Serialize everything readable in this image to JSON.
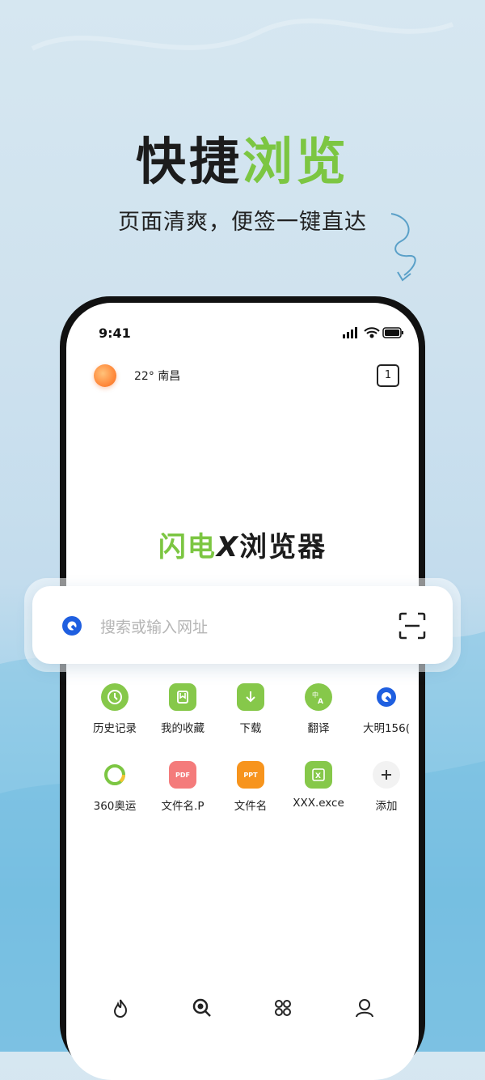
{
  "hero": {
    "title_dark": "快捷",
    "title_green": "浏览",
    "subtitle": "页面清爽，便签一键直达"
  },
  "status_bar": {
    "time": "9:41"
  },
  "header": {
    "weather": "22° 南昌",
    "tab_count": "1"
  },
  "logo": {
    "part1": "闪电",
    "part2": "X",
    "part3": "浏览器"
  },
  "search": {
    "placeholder": "搜索或输入网址"
  },
  "shortcuts_row1": [
    {
      "label": "历史记录",
      "icon": "clock-icon",
      "color": "#86c84a"
    },
    {
      "label": "我的收藏",
      "icon": "bookmark-icon",
      "color": "#86c84a"
    },
    {
      "label": "下载",
      "icon": "download-icon",
      "color": "#86c84a"
    },
    {
      "label": "翻译",
      "icon": "translate-icon",
      "color": "#86c84a"
    },
    {
      "label": "大明156(",
      "icon": "browser-logo-icon",
      "color": "#1f5fe0"
    }
  ],
  "shortcuts_row2": [
    {
      "label": "360奥运",
      "icon": "ring-logo-icon",
      "color": "#7cc642"
    },
    {
      "label": "文件名.P",
      "icon": "pdf-icon",
      "color": "#f47b7b",
      "badge": "PDF"
    },
    {
      "label": "文件名",
      "icon": "ppt-icon",
      "color": "#f7941d",
      "badge": "PPT"
    },
    {
      "label": "XXX.exce",
      "icon": "excel-icon",
      "color": "#86c84a"
    },
    {
      "label": "添加",
      "icon": "add-icon",
      "color": "#f2f2f2"
    }
  ],
  "bottom_nav": [
    "fire-icon",
    "search-icon",
    "apps-icon",
    "user-icon"
  ],
  "colors": {
    "accent_green": "#7cc642",
    "brand_blue": "#1f5fe0"
  }
}
